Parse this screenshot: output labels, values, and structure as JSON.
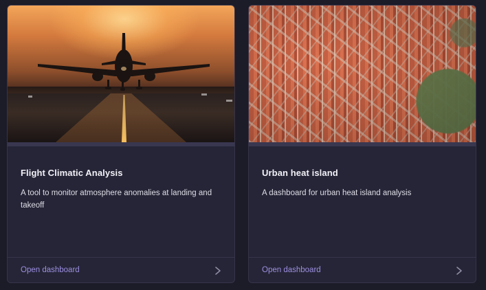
{
  "cards": [
    {
      "image": "airplane-landing-sunset",
      "title": "Flight Climatic Analysis",
      "description": "A tool to monitor atmosphere anomalies at landing and takeoff",
      "action_label": "Open dashboard",
      "action_icon": "chevron-right-icon"
    },
    {
      "image": "aerial-city-rooftops",
      "title": "Urban heat island",
      "description": "A dashboard for urban heat island analysis",
      "action_label": "Open dashboard",
      "action_icon": "chevron-right-icon"
    }
  ],
  "colors": {
    "page_background": "#1c1b28",
    "card_background": "#252537",
    "card_border": "#363449",
    "accent": "#9d8fe0",
    "title_text": "#f2f1f7"
  }
}
